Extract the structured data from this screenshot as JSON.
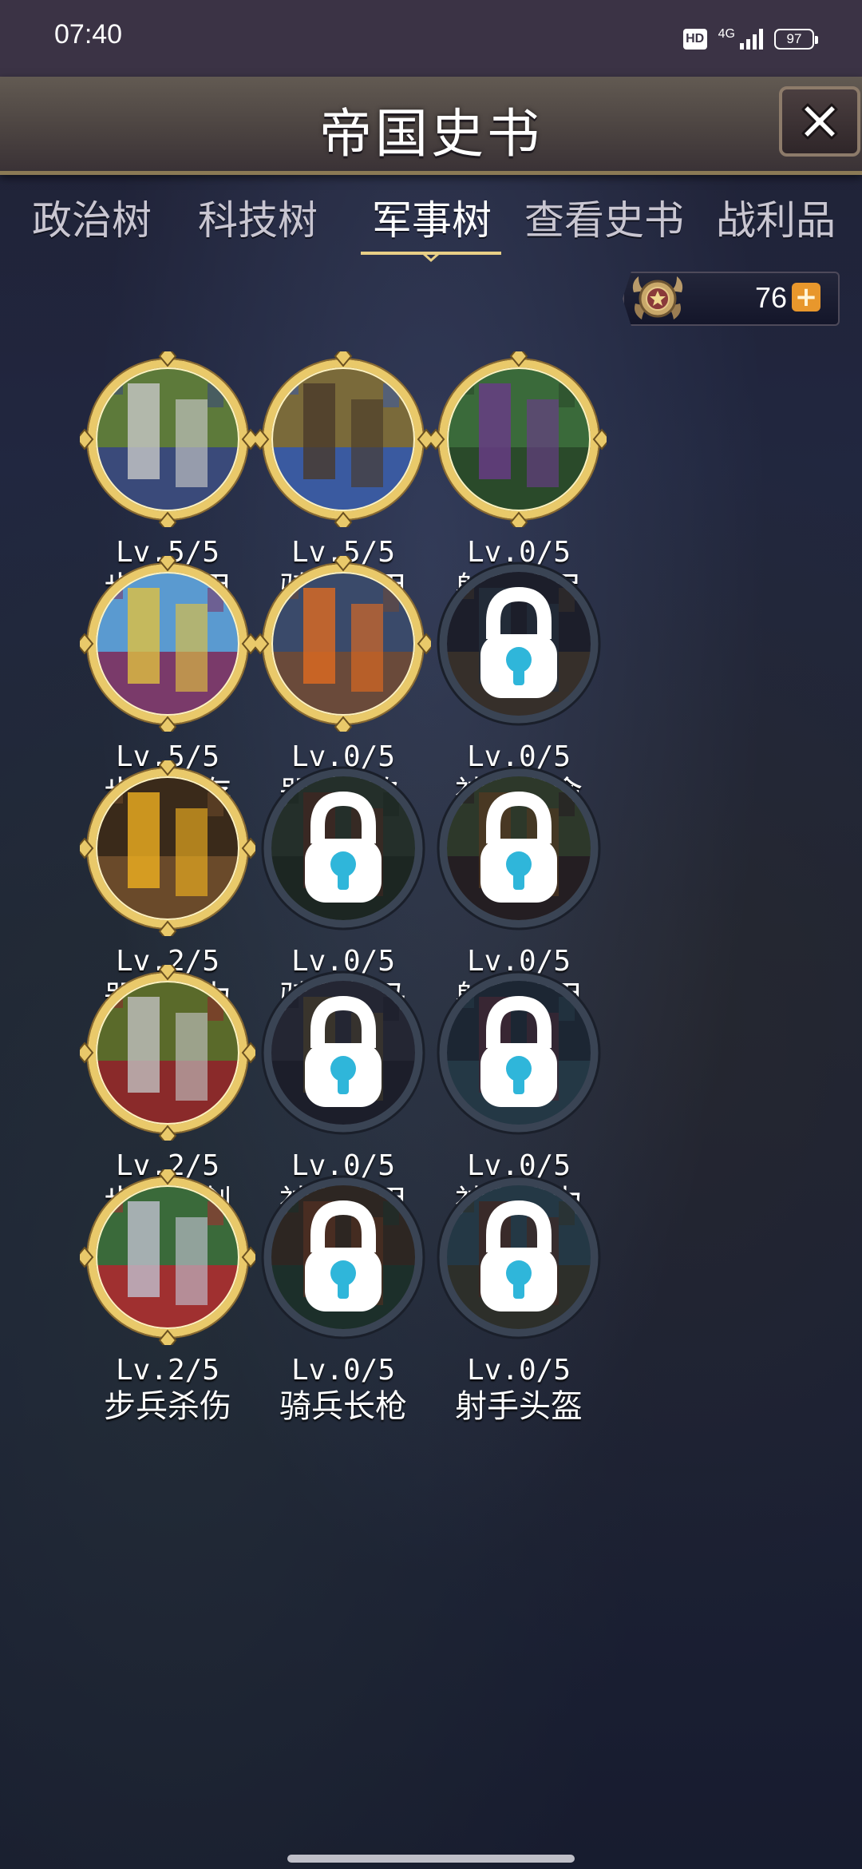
{
  "status_bar": {
    "time": "07:40",
    "hd": "HD",
    "network": "4G",
    "battery": "97"
  },
  "header": {
    "title": "帝国史书",
    "close_icon": "close-x-icon"
  },
  "tabs": [
    {
      "label": "政治树",
      "active": false
    },
    {
      "label": "科技树",
      "active": false
    },
    {
      "label": "军事树",
      "active": true
    },
    {
      "label": "查看史书",
      "active": false
    },
    {
      "label": "战利品",
      "active": false
    }
  ],
  "currency": {
    "icon": "medal-emblem-icon",
    "amount": "76",
    "add_label": "+"
  },
  "colors": {
    "gold_ring": "#e9c96a",
    "locked_ring": "#3a4454",
    "lock_icon": "#2fb6da",
    "add_button": "#e8972c"
  },
  "skills": [
    {
      "level": "Lv.5/5",
      "name": "步兵鳞甲",
      "locked": false,
      "art": "knights-icon"
    },
    {
      "level": "Lv.5/5",
      "name": "骑兵钢甲",
      "locked": false,
      "art": "cavalry-icon"
    },
    {
      "level": "Lv.0/5",
      "name": "射手重弓",
      "locked": false,
      "art": "archers-icon"
    },
    {
      "level": "Lv.5/5",
      "name": "步兵生存",
      "locked": false,
      "art": "warrior-icon"
    },
    {
      "level": "Lv.0/5",
      "name": "器械耐久",
      "locked": false,
      "art": "burning-castle-icon"
    },
    {
      "level": "Lv.0/5",
      "name": "神职寿命",
      "locked": true,
      "art": "lock-icon"
    },
    {
      "level": "Lv.2/5",
      "name": "器械威力",
      "locked": false,
      "art": "forge-icon"
    },
    {
      "level": "Lv.0/5",
      "name": "骑兵战马",
      "locked": true,
      "art": "lock-icon"
    },
    {
      "level": "Lv.0/5",
      "name": "射手软甲",
      "locked": true,
      "art": "lock-icon"
    },
    {
      "level": "Lv.2/5",
      "name": "步兵大剑",
      "locked": false,
      "art": "greatsword-knight-icon"
    },
    {
      "level": "Lv.0/5",
      "name": "神职袍甲",
      "locked": true,
      "art": "lock-icon"
    },
    {
      "level": "Lv.0/5",
      "name": "神职魔力",
      "locked": true,
      "art": "lock-icon"
    },
    {
      "level": "Lv.2/5",
      "name": "步兵杀伤",
      "locked": false,
      "art": "shield-knight-icon"
    },
    {
      "level": "Lv.0/5",
      "name": "骑兵长枪",
      "locked": true,
      "art": "lock-icon"
    },
    {
      "level": "Lv.0/5",
      "name": "射手头盔",
      "locked": true,
      "art": "lock-icon"
    }
  ]
}
